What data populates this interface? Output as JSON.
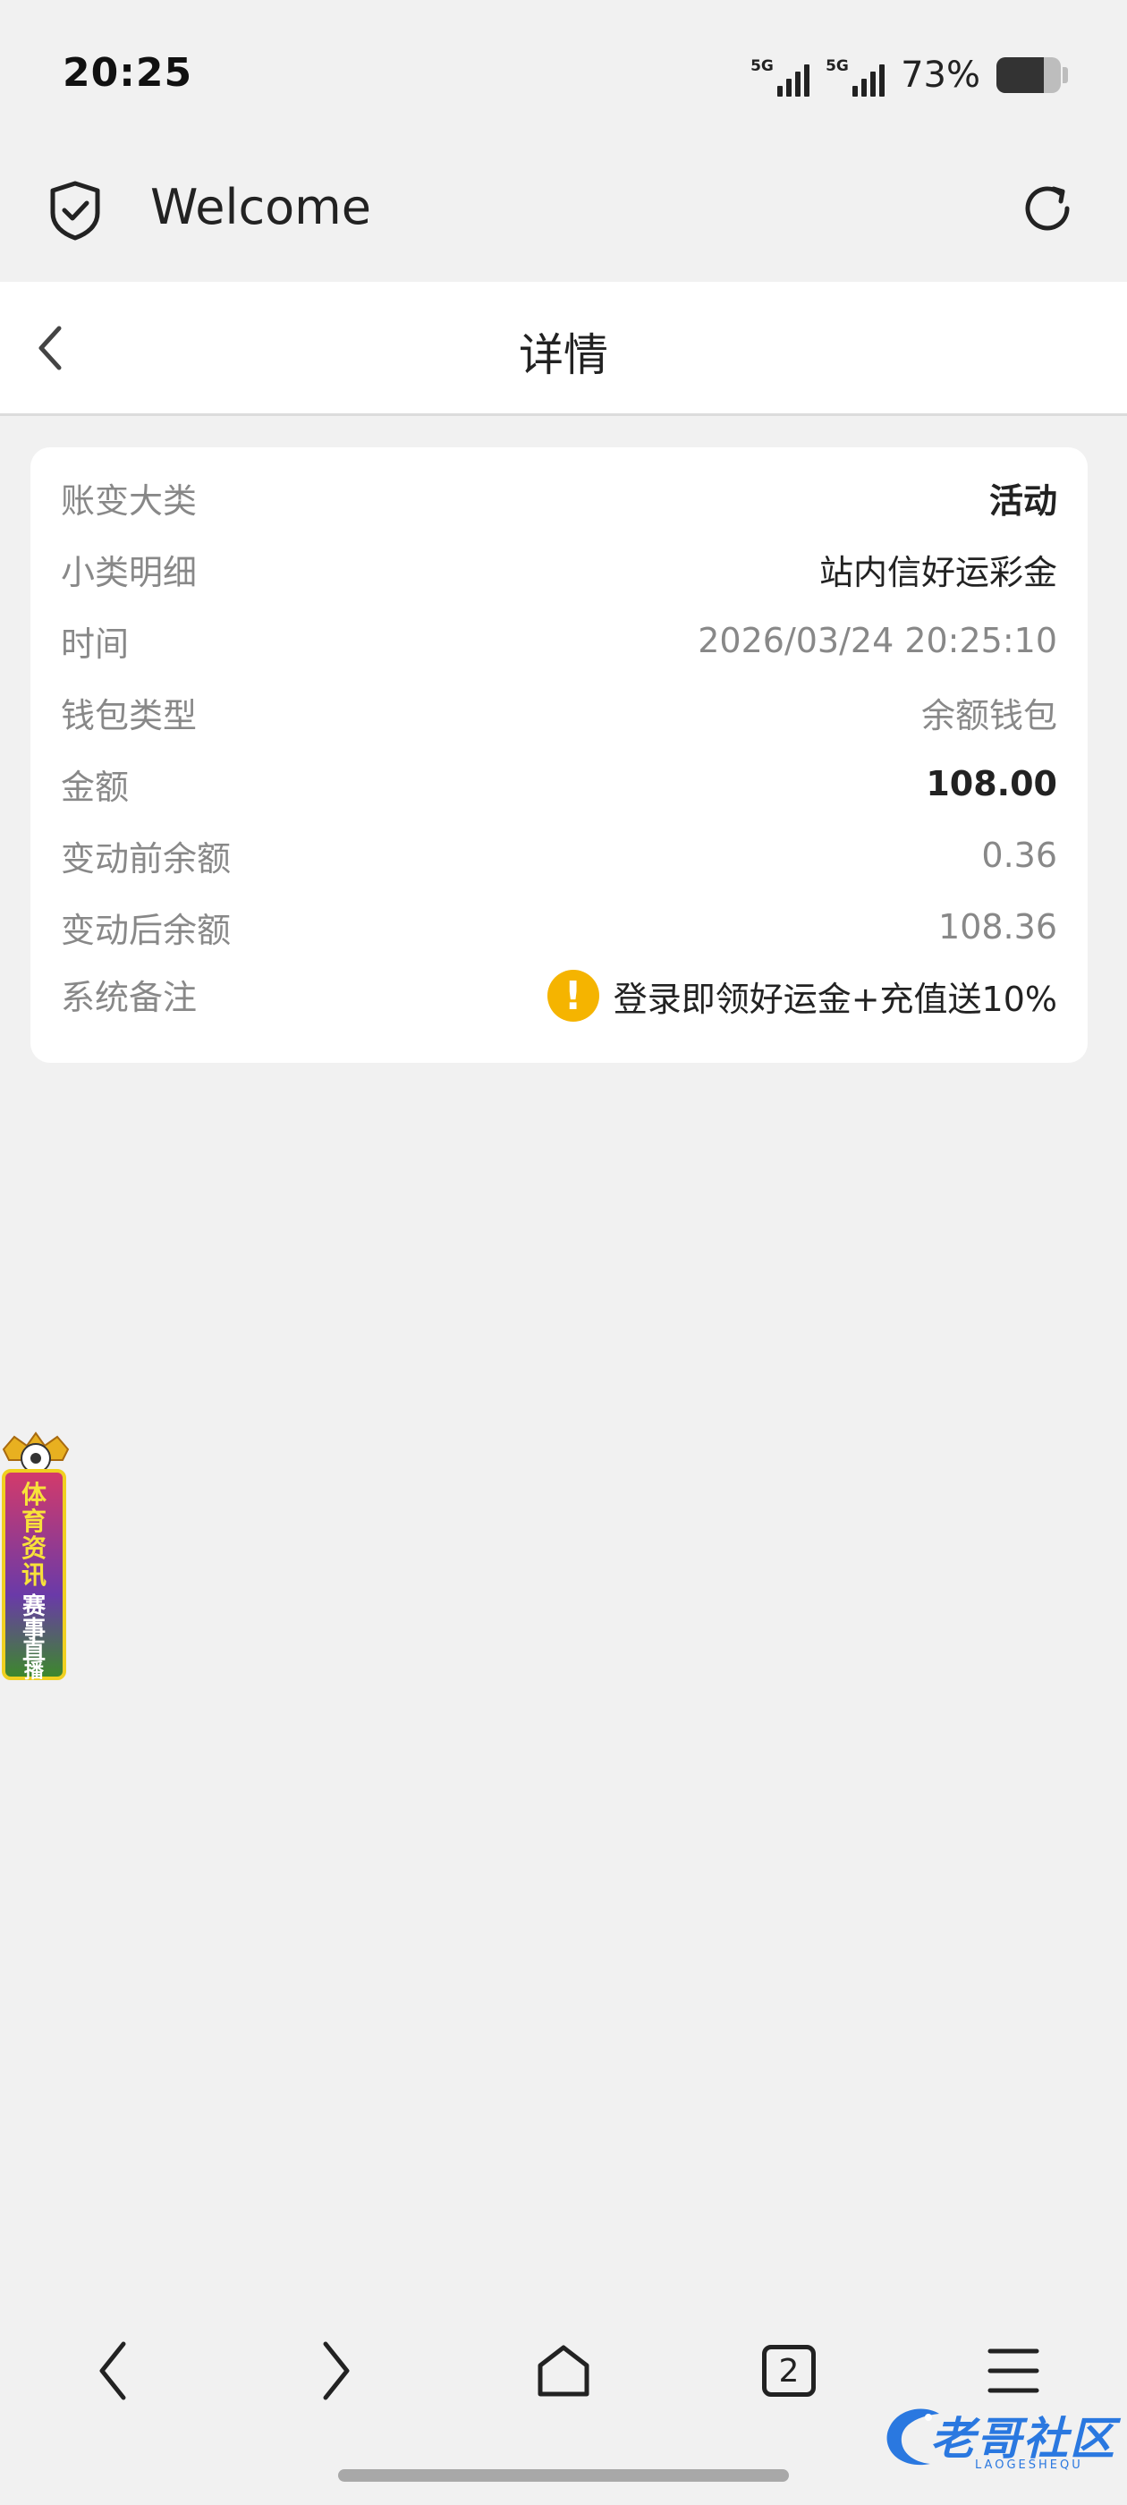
{
  "status_bar": {
    "time": "20:25",
    "signal_1_label": "5G",
    "signal_2_label": "5G",
    "battery_percent": "73%",
    "battery_level": 0.73
  },
  "browser": {
    "title": "Welcome",
    "icons": [
      "shield-check-icon",
      "refresh-icon"
    ]
  },
  "header": {
    "title": "详情",
    "back_icon": "chevron-left-icon"
  },
  "details": [
    {
      "label": "账变大类",
      "value": "活动"
    },
    {
      "label": "小类明细",
      "value": "站内信好运彩金"
    },
    {
      "label": "时间",
      "value": "2026/03/24 20:25:10"
    },
    {
      "label": "钱包类型",
      "value": "余额钱包"
    },
    {
      "label": "金额",
      "value": "108.00"
    },
    {
      "label": "变动前余额",
      "value": "0.36"
    },
    {
      "label": "变动后余额",
      "value": "108.36"
    },
    {
      "label": "系统备注",
      "value": "登录即领好运金+充值送10%"
    }
  ],
  "side_banner": {
    "text": "体育资讯赛事直播"
  },
  "bottom_nav": {
    "items": [
      "back-icon",
      "forward-icon",
      "home-icon",
      "tabs-icon",
      "menu-icon"
    ],
    "tabs_count": "2"
  },
  "watermark": {
    "text": "老哥社区",
    "sub": "LAOGESHEQU"
  },
  "colors": {
    "background": "#f1f1f1",
    "card": "#ffffff",
    "warning": "#f5b400",
    "watermark": "#2a78e0"
  }
}
